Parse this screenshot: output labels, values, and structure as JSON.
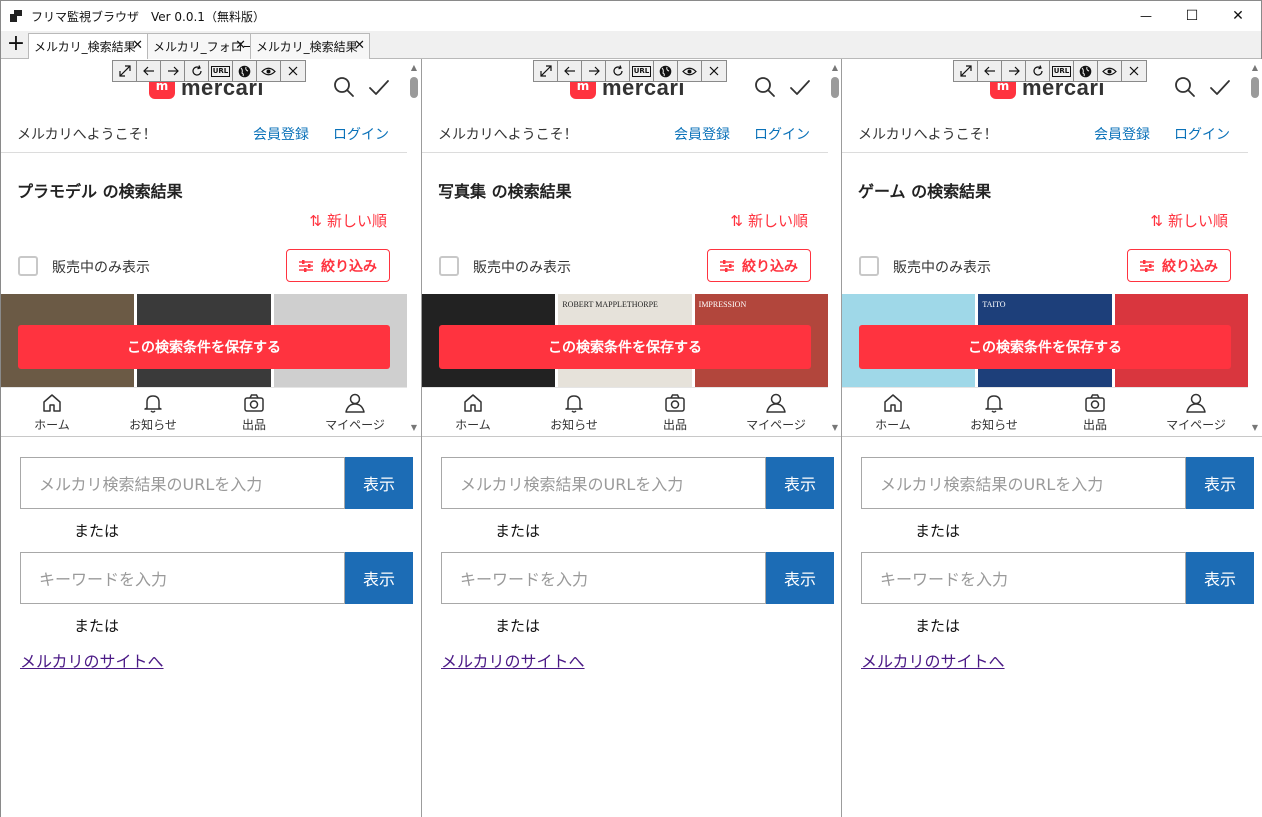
{
  "window": {
    "title": "フリマ監視ブラウザ　Ver 0.0.1（無料版）",
    "minimize": "—",
    "maximize": "☐",
    "close": "✕"
  },
  "tabs": {
    "add": "+",
    "items": [
      {
        "label": "メルカリ_検索結果",
        "close": "✕"
      },
      {
        "label": "メルカリ_フォロー",
        "close": "✕"
      },
      {
        "label": "メルカリ_検索結果",
        "close": "✕"
      }
    ]
  },
  "toolbar": {
    "url_label": "URL"
  },
  "mercari": {
    "logo_mark": "m",
    "logo_text": "mercari",
    "welcome": "メルカリへようこそ！",
    "register": "会員登録",
    "login": "ログイン",
    "sort": "新しい順",
    "sort_icon": "⇅",
    "on_sale_only": "販売中のみ表示",
    "filter": "絞り込み",
    "save_search": "この検索条件を保存する",
    "nav": {
      "home": "ホーム",
      "notifications": "お知らせ",
      "sell": "出品",
      "mypage": "マイページ"
    }
  },
  "panes": [
    {
      "result_title": "プラモデル の検索結果",
      "thumb_colors": [
        "#6b5a45",
        "#3a3a3a",
        "#cfcfcf"
      ],
      "thumb_text": [
        "",
        "",
        ""
      ]
    },
    {
      "result_title": "写真集 の検索結果",
      "thumb_colors": [
        "#222222",
        "#e6e2da",
        "#b2463c"
      ],
      "thumb_text": [
        "",
        "ROBERT MAPPLETHORPE",
        "IMPRESSION"
      ]
    },
    {
      "result_title": "ゲーム の検索結果",
      "thumb_colors": [
        "#9fd8e8",
        "#1d3f7a",
        "#d9363e"
      ],
      "thumb_text": [
        "",
        "TAITO",
        ""
      ]
    }
  ],
  "form": {
    "url_placeholder": "メルカリ検索結果のURLを入力",
    "keyword_placeholder": "キーワードを入力",
    "show_button": "表示",
    "or_text": "または",
    "site_link": "メルカリのサイトへ"
  },
  "colors": {
    "mercari_red": "#ff333f",
    "link_blue": "#0b72b9",
    "show_button_blue": "#1c6cb5",
    "visited_link": "#4b1a86"
  }
}
